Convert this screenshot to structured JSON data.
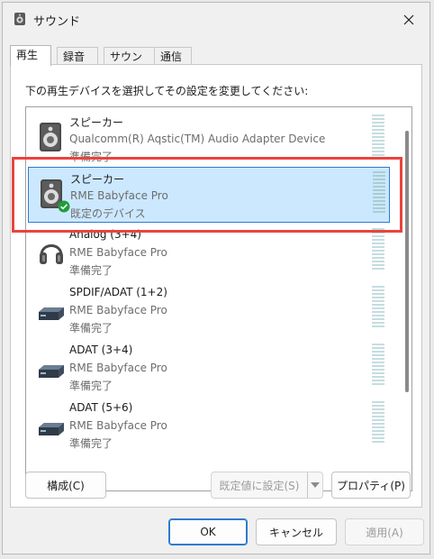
{
  "window": {
    "title": "サウンド"
  },
  "tabs": [
    {
      "label": "再生"
    },
    {
      "label": "録音"
    },
    {
      "label": "サウンド"
    },
    {
      "label": "通信"
    }
  ],
  "instruction": "下の再生デバイスを選択してその設定を変更してください:",
  "devices": [
    {
      "name": "スピーカー",
      "description": "Qualcomm(R) Aqstic(TM) Audio Adapter Device",
      "status": "準備完了",
      "icon": "speaker-icon",
      "selected": false
    },
    {
      "name": "スピーカー",
      "description": "RME Babyface Pro",
      "status": "既定のデバイス",
      "icon": "speaker-icon",
      "default_badge": "check-icon",
      "selected": true
    },
    {
      "name": "Analog (3+4)",
      "description": "RME Babyface Pro",
      "status": "準備完了",
      "icon": "headphones-icon",
      "selected": false
    },
    {
      "name": "SPDIF/ADAT (1+2)",
      "description": "RME Babyface Pro",
      "status": "準備完了",
      "icon": "digital-output-icon",
      "selected": false
    },
    {
      "name": "ADAT (3+4)",
      "description": "RME Babyface Pro",
      "status": "準備完了",
      "icon": "digital-output-icon",
      "selected": false
    },
    {
      "name": "ADAT (5+6)",
      "description": "RME Babyface Pro",
      "status": "準備完了",
      "icon": "digital-output-icon",
      "selected": false
    }
  ],
  "buttons": {
    "configure": "構成(C)",
    "set_default": "既定値に設定(S)",
    "properties": "プロパティ(P)",
    "ok": "OK",
    "cancel": "キャンセル",
    "apply": "適用(A)"
  },
  "colors": {
    "selection_bg": "#cce8ff",
    "selection_border": "#2d7bd1",
    "annotation_red": "#e8453c",
    "default_check": "#1e9e3a"
  }
}
